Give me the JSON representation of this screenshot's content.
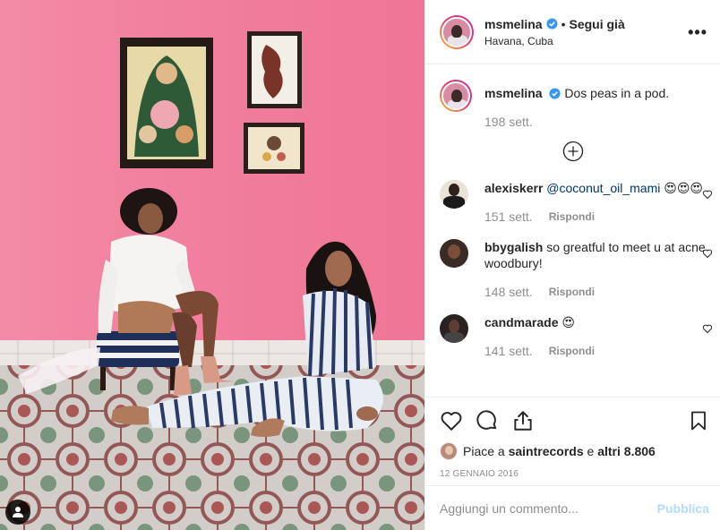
{
  "post": {
    "author": "msmelina",
    "follow_label": "Segui già",
    "separator": "•",
    "location": "Havana, Cuba",
    "more_label": "•••"
  },
  "caption": {
    "username": "msmelina",
    "text": "Dos peas in a pod.",
    "time": "198 sett."
  },
  "comments": [
    {
      "username": "alexiskerr",
      "mention": "@coconut_oil_mami",
      "text": "😍😍😍",
      "time": "151 sett.",
      "reply_label": "Rispondi"
    },
    {
      "username": "bbygalish",
      "mention": "",
      "text": "so greatful to meet u at acne woodbury!",
      "time": "148 sett.",
      "reply_label": "Rispondi"
    },
    {
      "username": "candmarade",
      "mention": "",
      "text": "😍",
      "time": "141 sett.",
      "reply_label": "Rispondi"
    }
  ],
  "likes": {
    "prefix": "Piace a",
    "user": "saintrecords",
    "middle": "e",
    "others": "altri 8.806"
  },
  "date": "12 GENNAIO 2016",
  "composer": {
    "placeholder": "Aggiungi un commento...",
    "publish_label": "Pubblica"
  },
  "colors": {
    "wall_pink": "#f07a98",
    "link_blue": "#00376b",
    "publish_disabled": "#b3dbff",
    "verified_blue": "#3897f0"
  }
}
